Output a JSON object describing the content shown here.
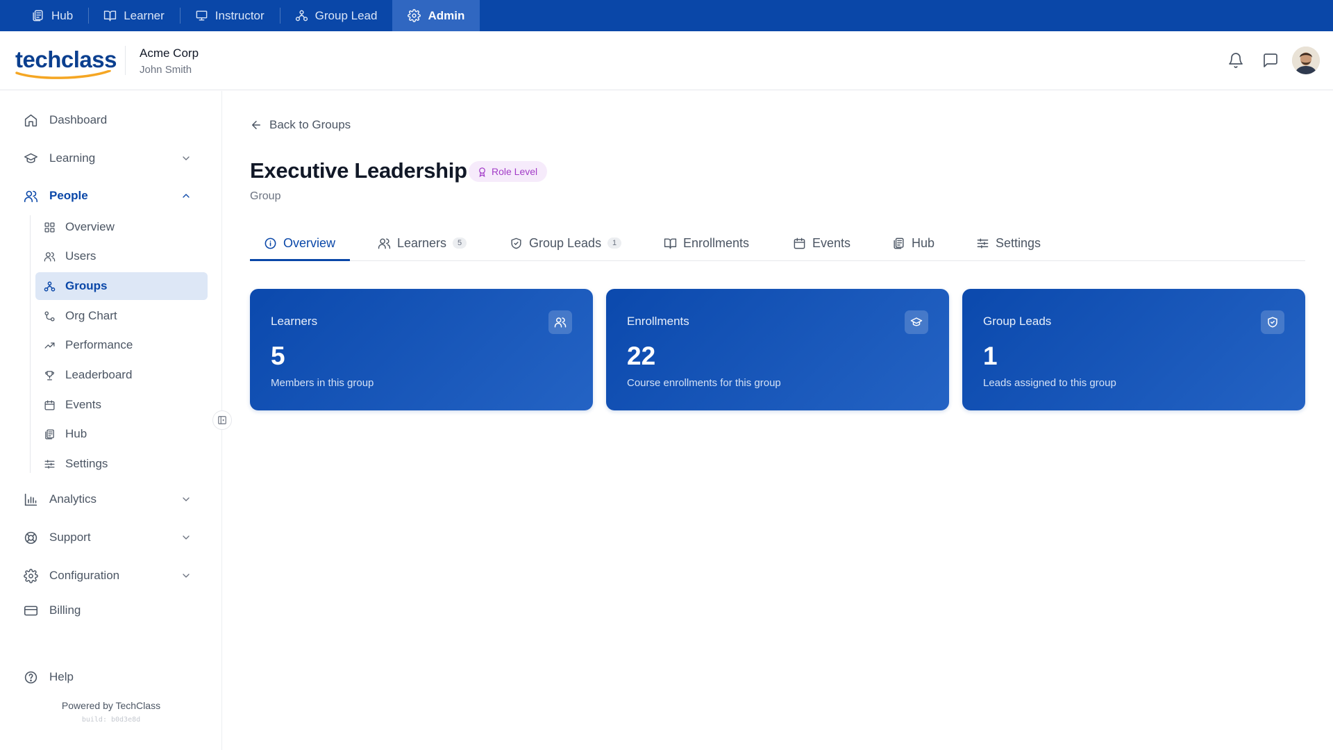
{
  "colors": {
    "primary": "#0a47a8",
    "active_role_bg": "#3067c1",
    "badge_text": "#a23cc7",
    "badge_bg": "#f6ebfb",
    "logo_accent": "#f5a623"
  },
  "role_tabs": [
    {
      "label": "Hub",
      "icon": "hub-icon"
    },
    {
      "label": "Learner",
      "icon": "book-icon"
    },
    {
      "label": "Instructor",
      "icon": "presentation-icon"
    },
    {
      "label": "Group Lead",
      "icon": "group-lead-icon"
    },
    {
      "label": "Admin",
      "icon": "gear-icon",
      "active": true
    }
  ],
  "header": {
    "logo_text": "techclass",
    "org_name": "Acme Corp",
    "user_name": "John Smith"
  },
  "sidebar": {
    "items": [
      {
        "label": "Dashboard",
        "icon": "home-icon"
      },
      {
        "label": "Learning",
        "icon": "graduation-cap-icon",
        "expandable": true
      },
      {
        "label": "People",
        "icon": "users-icon",
        "expandable": true,
        "expanded": true
      },
      {
        "label": "Analytics",
        "icon": "bar-chart-icon",
        "expandable": true
      },
      {
        "label": "Support",
        "icon": "lifebuoy-icon",
        "expandable": true
      },
      {
        "label": "Configuration",
        "icon": "gear-icon",
        "expandable": true
      },
      {
        "label": "Billing",
        "icon": "credit-card-icon"
      }
    ],
    "people_sub": [
      {
        "label": "Overview",
        "icon": "grid-icon"
      },
      {
        "label": "Users",
        "icon": "users-icon"
      },
      {
        "label": "Groups",
        "icon": "group-icon",
        "active": true
      },
      {
        "label": "Org Chart",
        "icon": "org-chart-icon"
      },
      {
        "label": "Performance",
        "icon": "trend-icon"
      },
      {
        "label": "Leaderboard",
        "icon": "trophy-icon"
      },
      {
        "label": "Events",
        "icon": "calendar-icon"
      },
      {
        "label": "Hub",
        "icon": "hub-icon"
      },
      {
        "label": "Settings",
        "icon": "sliders-icon"
      }
    ],
    "help": "Help",
    "powered_by": "Powered by TechClass",
    "build": "build: b0d3e8d"
  },
  "main": {
    "back_label": "Back to Groups",
    "title": "Executive Leadership",
    "badge": "Role Level",
    "subtitle": "Group",
    "tabs": [
      {
        "label": "Overview",
        "icon": "info-icon",
        "active": true
      },
      {
        "label": "Learners",
        "icon": "users-icon",
        "count": "5"
      },
      {
        "label": "Group Leads",
        "icon": "shield-icon",
        "count": "1"
      },
      {
        "label": "Enrollments",
        "icon": "book-icon"
      },
      {
        "label": "Events",
        "icon": "calendar-icon"
      },
      {
        "label": "Hub",
        "icon": "hub-icon"
      },
      {
        "label": "Settings",
        "icon": "sliders-icon"
      }
    ],
    "cards": [
      {
        "label": "Learners",
        "value": "5",
        "desc": "Members in this group",
        "icon": "users-icon"
      },
      {
        "label": "Enrollments",
        "value": "22",
        "desc": "Course enrollments for this group",
        "icon": "graduation-cap-icon"
      },
      {
        "label": "Group Leads",
        "value": "1",
        "desc": "Leads assigned to this group",
        "icon": "shield-check-icon"
      }
    ]
  }
}
